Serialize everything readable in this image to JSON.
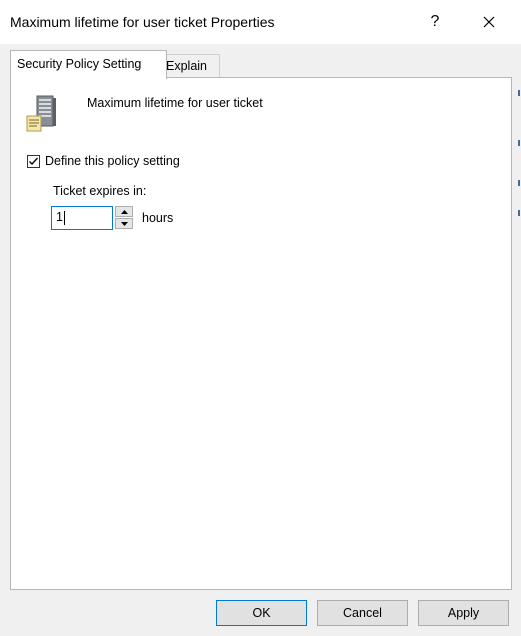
{
  "window": {
    "title": "Maximum lifetime for user ticket Properties"
  },
  "titlebar": {
    "help_label": "?",
    "close_label": "✕"
  },
  "tabs": [
    {
      "label": "Security Policy Setting",
      "active": true
    },
    {
      "label": "Explain",
      "active": false
    }
  ],
  "policy": {
    "icon": "server-policy-icon",
    "name": "Maximum lifetime for user ticket",
    "define_label": "Define this policy setting",
    "define_checked": true,
    "expires_label": "Ticket expires in:",
    "value": "1",
    "unit": "hours"
  },
  "buttons": {
    "ok": "OK",
    "cancel": "Cancel",
    "apply": "Apply"
  },
  "colors": {
    "accent": "#0078d7",
    "dialog_bg": "#f0f0f0"
  }
}
